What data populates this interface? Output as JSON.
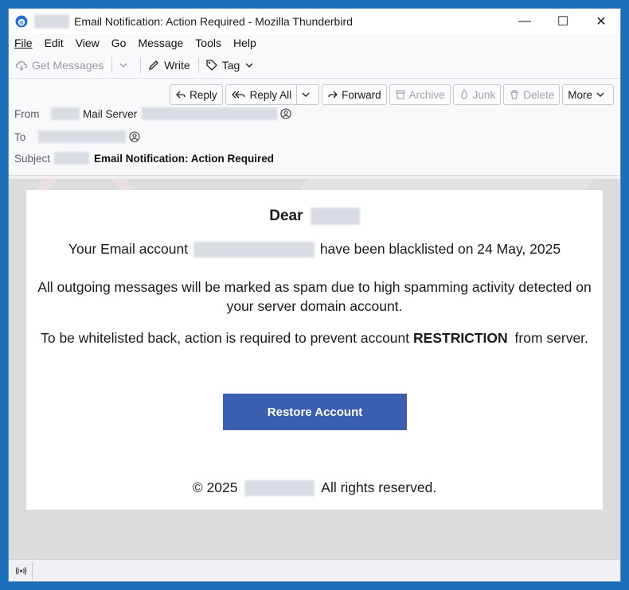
{
  "window": {
    "title": "Email Notification: Action Required - Mozilla Thunderbird",
    "minimize_glyph": "—",
    "maximize_glyph": "☐",
    "close_glyph": "✕"
  },
  "menu": {
    "file": "File",
    "edit": "Edit",
    "view": "View",
    "go": "Go",
    "message": "Message",
    "tools": "Tools",
    "help": "Help"
  },
  "toolbar": {
    "get_messages": "Get Messages",
    "write": "Write",
    "tag": "Tag"
  },
  "actions": {
    "reply": "Reply",
    "reply_all": "Reply All",
    "forward": "Forward",
    "archive": "Archive",
    "junk": "Junk",
    "delete": "Delete",
    "more": "More"
  },
  "headers": {
    "from_label": "From",
    "from_name": "Mail Server",
    "to_label": "To",
    "subject_label": "Subject",
    "subject": "Email Notification: Action Required"
  },
  "message": {
    "dear": "Dear",
    "line1_prefix": "Your Email account",
    "line1_suffix": "have been blacklisted on 24 May, 2025",
    "line2": "All outgoing messages will be marked as spam due to high spamming activity detected on your server domain account.",
    "line3_prefix": "To be whitelisted back, action is required to prevent account",
    "line3_bold": "RESTRICTION",
    "line3_suffix": "from server.",
    "button": "Restore Account",
    "footer_prefix": "© 2025",
    "footer_suffix": "All rights reserved."
  },
  "colors": {
    "accent_button": "#3b5fb0",
    "title_icon": "#1e6fd9"
  }
}
